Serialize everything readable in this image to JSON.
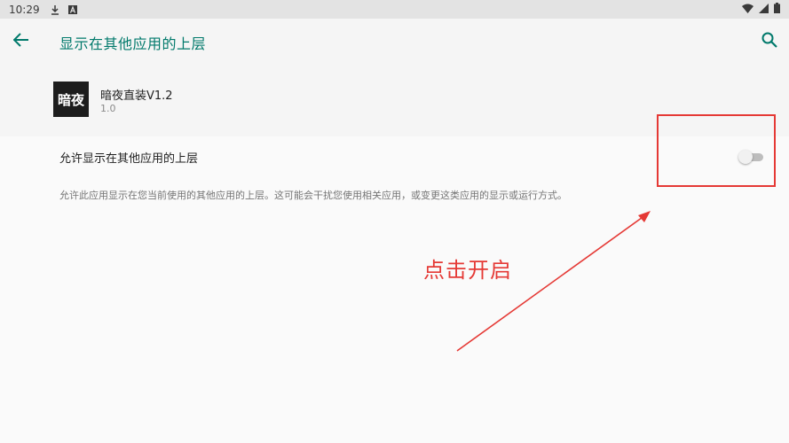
{
  "status_bar": {
    "time": "10:29",
    "icons": [
      "download-icon",
      "a-icon"
    ],
    "right_icons": [
      "wifi-icon",
      "signal-icon",
      "battery-icon"
    ]
  },
  "app_bar": {
    "title": "显示在其他应用的上层",
    "back_icon": "arrow-back-icon",
    "search_icon": "search-icon",
    "title_color": "#00796b"
  },
  "app": {
    "icon_text": "暗夜",
    "name": "暗夜直装V1.2",
    "version": "1.0"
  },
  "setting": {
    "label": "允许显示在其他应用的上层",
    "enabled": false,
    "description": "允许此应用显示在您当前使用的其他应用的上层。这可能会干扰您使用相关应用，或变更这类应用的显示或运行方式。"
  },
  "annotation": {
    "text": "点击开启",
    "color": "#e53935"
  }
}
